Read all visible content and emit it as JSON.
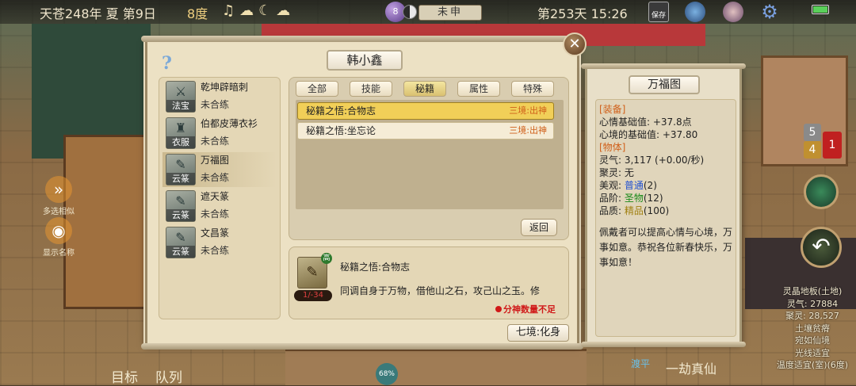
{
  "topbar": {
    "date": "天苍248年 夏 第9日",
    "temperature": "8度",
    "dial_label": "8",
    "clock_band": "未申",
    "day_time": "第253天 15:26",
    "save_label": "保存"
  },
  "left_icons": {
    "multi_select": "多选相似",
    "show_names": "显示名称",
    "goal": "目标",
    "queue": "队列"
  },
  "dialog": {
    "character_name": "韩小鑫",
    "items": [
      {
        "name": "乾坤辟暗刺",
        "status": "未合练",
        "kind": "法宝"
      },
      {
        "name": "伯都皮薄衣衫",
        "status": "未合练",
        "kind": "衣服"
      },
      {
        "name": "万福图",
        "status": "未合练",
        "kind": "云篆"
      },
      {
        "name": "遮天篆",
        "status": "未合练",
        "kind": "云篆"
      },
      {
        "name": "文昌篆",
        "status": "未合练",
        "kind": "云篆"
      }
    ],
    "tabs": [
      "全部",
      "技能",
      "秘籍",
      "属性",
      "特殊"
    ],
    "active_tab": "秘籍",
    "books": [
      {
        "name": "秘籍之悟:合物志",
        "level": "三境:出神"
      },
      {
        "name": "秘籍之悟:坐忘论",
        "level": "三境:出神"
      }
    ],
    "back_label": "返回",
    "detail": {
      "badge": "高",
      "count": "1/-34",
      "name": "秘籍之悟:合物志",
      "description": "同调自身于万物，借他山之石，攻己山之玉。修",
      "warning": "分神数量不足"
    },
    "realm_label": "七境:化身"
  },
  "info_panel": {
    "title": "万福图",
    "equip_header": "[装备]",
    "mood_base": "心情基础值: +37.8点",
    "mind_base": "心境的基础值: +37.80",
    "object_header": "[物体]",
    "qi_label": "灵气: ",
    "qi_value": "3,117 (+0.00/秒)",
    "spirit_label": "聚灵: ",
    "spirit_value": "无",
    "beauty_label": "美观: ",
    "beauty_value": "普通",
    "beauty_num": "(2)",
    "grade_label": "品阶: ",
    "grade_value": "圣物",
    "grade_num": "(12)",
    "quality_label": "品质: ",
    "quality_value": "精品",
    "quality_num": "(100)",
    "flavor": "佩戴者可以提高心情与心境，万事如意。恭祝各位新春快乐，万事如意！"
  },
  "world_info": {
    "tile": "灵晶地板(土地)",
    "qi": "灵气: 27884",
    "spirit": "聚灵: 28,527",
    "soil": "土壤贫瘠",
    "place": "宛如仙境",
    "light": "光线适宜",
    "temp": "温度适宜(室)(6度)"
  },
  "badges": {
    "five": "5",
    "four": "4",
    "one": "1"
  },
  "bottom": {
    "timer": "68%",
    "kalpa_icon": "渡平",
    "kalpa": "一劫真仙"
  },
  "colors": {
    "parchment": "#ece1c4",
    "selected_row": "#f1cf58",
    "level_text": "#d0601a",
    "warning": "#d01818"
  }
}
